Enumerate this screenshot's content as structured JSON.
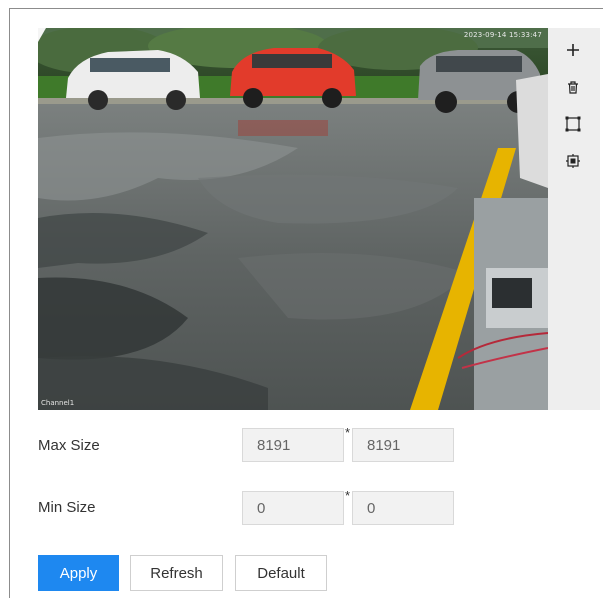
{
  "video": {
    "timestamp": "2023-09-14 15:33:47",
    "channel_name": "Channel1"
  },
  "toolbar": {
    "tools": [
      {
        "name": "add-icon"
      },
      {
        "name": "delete-icon"
      },
      {
        "name": "draw-target-icon"
      },
      {
        "name": "clear-target-icon"
      }
    ]
  },
  "form": {
    "max_size": {
      "label": "Max Size",
      "width": "8191",
      "height": "8191"
    },
    "min_size": {
      "label": "Min Size",
      "width": "0",
      "height": "0"
    },
    "separator": "*"
  },
  "buttons": {
    "apply": "Apply",
    "refresh": "Refresh",
    "default": "Default"
  },
  "colors": {
    "primary": "#1e88f0",
    "toolbar_bg": "#eeeeee",
    "field_bg": "#f2f2f2"
  }
}
